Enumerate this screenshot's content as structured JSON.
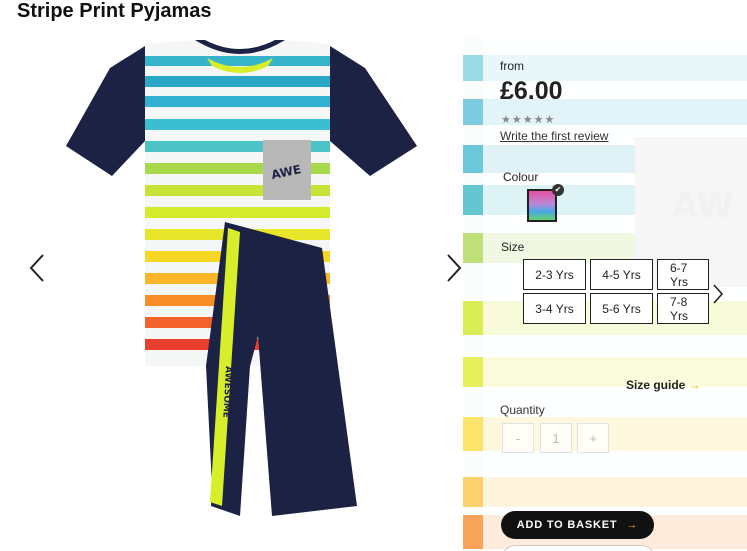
{
  "product": {
    "title": "Stripe Print Pyjamas"
  },
  "pricing": {
    "from_label": "from",
    "price": "£6.00",
    "stars": "★★★★★",
    "review_link": "Write the first review"
  },
  "colour": {
    "label": "Colour",
    "selected_swatch": "multi-stripe"
  },
  "size": {
    "label": "Size",
    "options": [
      "2-3 Yrs",
      "4-5 Yrs",
      "6-7 Yrs",
      "3-4 Yrs",
      "5-6 Yrs",
      "7-8 Yrs"
    ],
    "guide_label": "Size guide",
    "guide_arrow": "→"
  },
  "quantity": {
    "label": "Quantity",
    "minus": "-",
    "value": "1",
    "plus": "+"
  },
  "basket": {
    "label": "ADD TO BASKET",
    "arrow": "→"
  },
  "image": {
    "print_text": "AWESOME"
  },
  "colors": {
    "navy": "#1c2244",
    "lime": "#d6ef2a",
    "accent_arrow": "#f2b600"
  }
}
